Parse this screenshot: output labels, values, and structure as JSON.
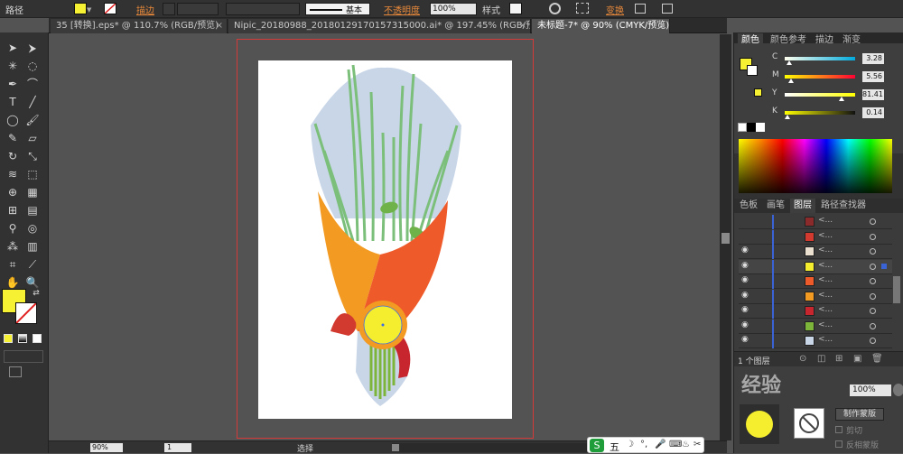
{
  "control_bar": {
    "mode_label": "路径",
    "stroke_label": "描边",
    "brush_label": "基本",
    "opacity_label": "不透明度",
    "opacity_value": "100%",
    "style_label": "样式",
    "transform_label": "变换"
  },
  "tabs": [
    {
      "label": "35 [转换].eps* @ 110.7% (RGB/预览)"
    },
    {
      "label": "Nipic_20180988_20180129170157315000.ai* @ 197.45% (RGB/预览)"
    },
    {
      "label": "未标题-7* @ 90% (CMYK/预览)"
    }
  ],
  "color_panel": {
    "tabs": [
      "颜色",
      "颜色参考",
      "描边",
      "渐变"
    ],
    "channels": [
      {
        "name": "C",
        "value": "3.28",
        "pos": 0.0328
      },
      {
        "name": "M",
        "value": "5.56",
        "pos": 0.0556
      },
      {
        "name": "Y",
        "value": "81.41",
        "pos": 0.8141
      },
      {
        "name": "K",
        "value": "0.14",
        "pos": 0.0014
      }
    ]
  },
  "layers_panel": {
    "tabs": [
      "色板",
      "画笔",
      "图层",
      "路径查找器"
    ],
    "rows": [
      {
        "name": "<...",
        "color": "#8a2a2a"
      },
      {
        "name": "<...",
        "color": "#d23a30"
      },
      {
        "name": "<...",
        "color": "#ebe0d0"
      },
      {
        "name": "<...",
        "color": "#f5ee2e",
        "selected": true
      },
      {
        "name": "<...",
        "color": "#ef5a2a"
      },
      {
        "name": "<...",
        "color": "#f39a22"
      },
      {
        "name": "<...",
        "color": "#c8262e"
      },
      {
        "name": "<...",
        "color": "#7db43a"
      },
      {
        "name": "<...",
        "color": "#c8d6e8"
      }
    ],
    "footer": "1 个图层"
  },
  "transparency_panel": {
    "opacity_value": "100%",
    "make_mask": "制作蒙版",
    "clip": "剪切",
    "invert_mask": "反相蒙版"
  },
  "status_bar": {
    "zoom": "90%",
    "artboard_num": "1",
    "tool_name": "选择"
  },
  "ime_bar": {
    "label": "五"
  },
  "watermark": "经验",
  "colors": {
    "fill": "#f7f134",
    "accent_orange": "#e8893a"
  }
}
